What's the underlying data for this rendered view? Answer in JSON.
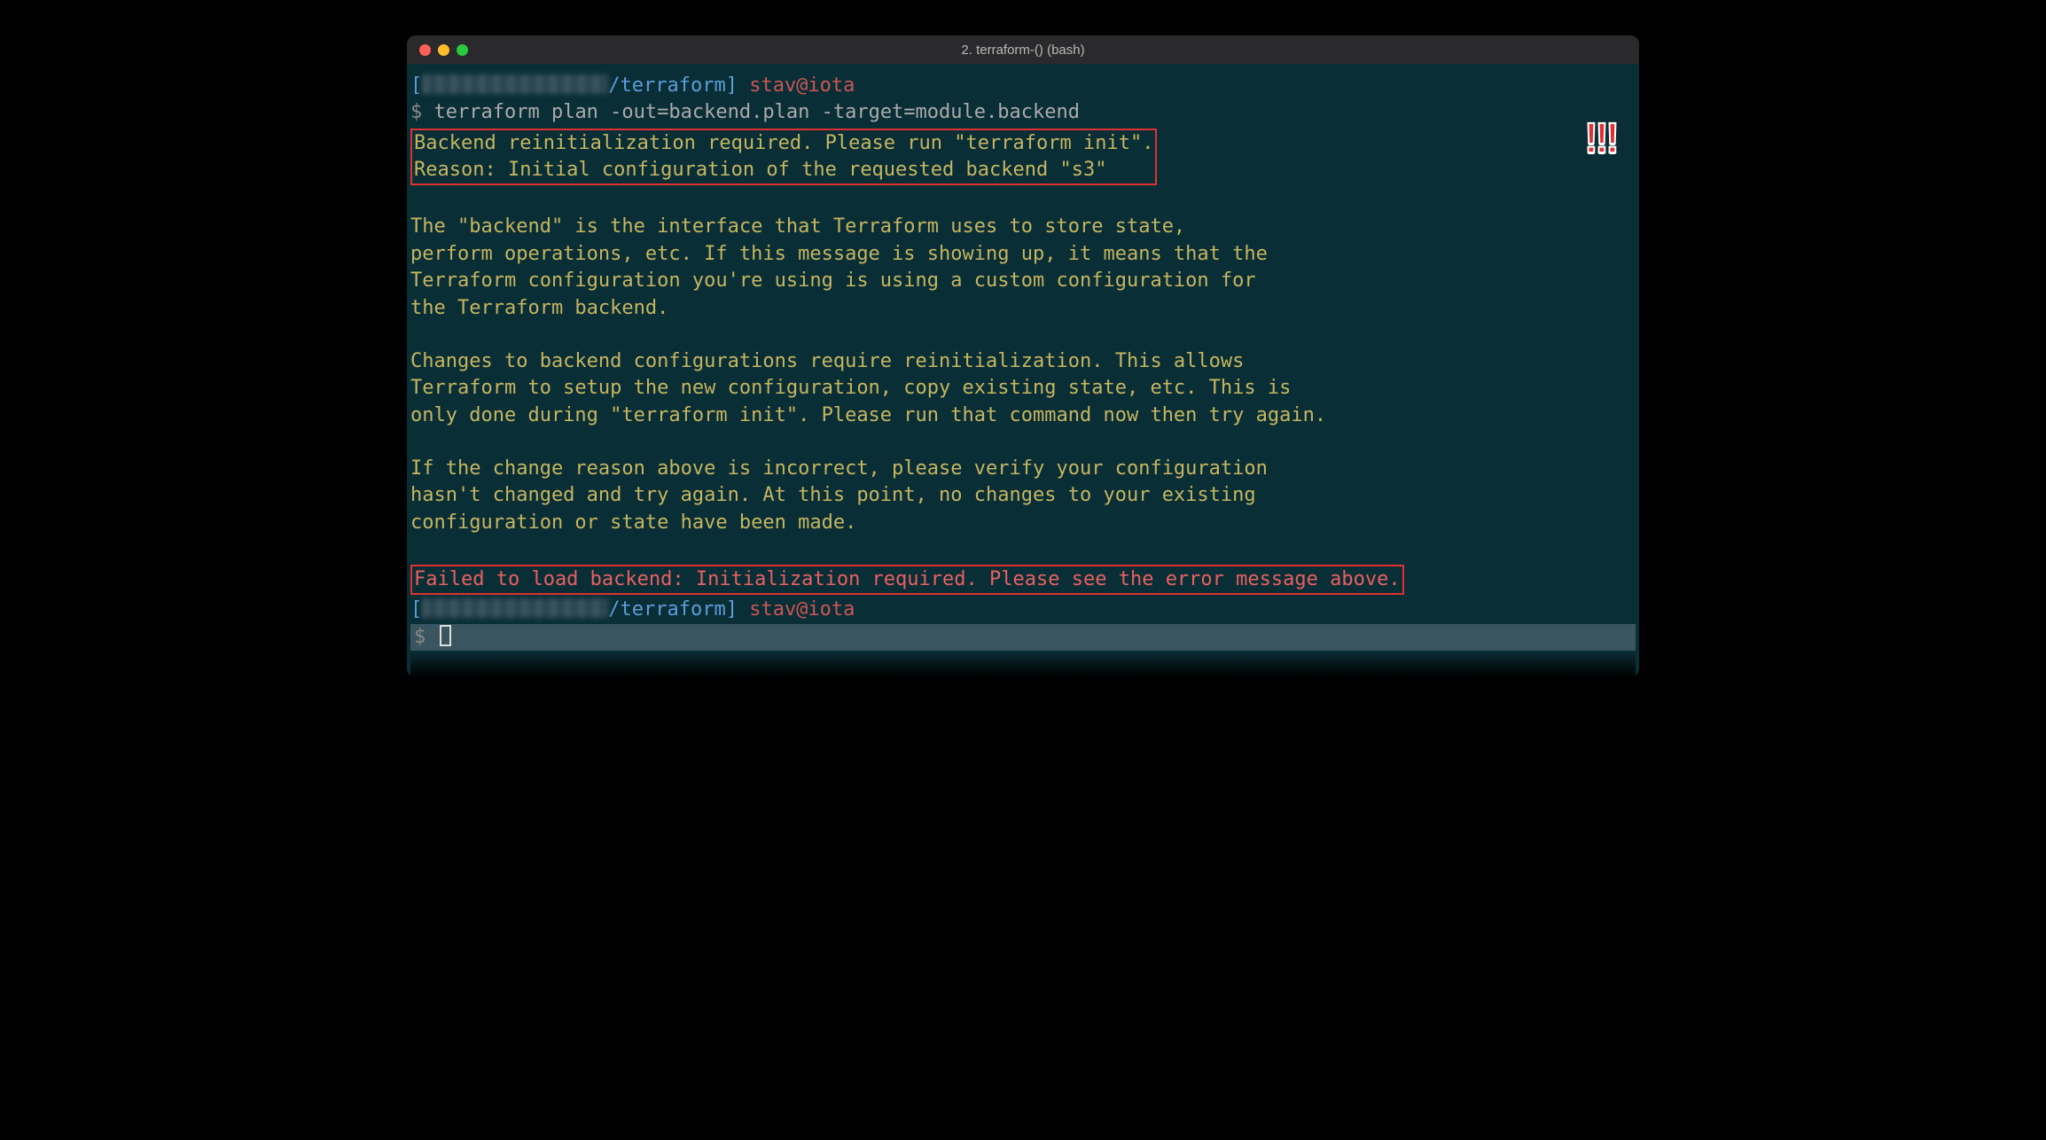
{
  "window_title": "2. terraform-() (bash)",
  "prompt1": {
    "bracket_open": "[",
    "path": "/terraform",
    "bracket_close": "] ",
    "userhost": "stav@iota"
  },
  "prompt_sym": "$ ",
  "command": "terraform plan -out=backend.plan -target=module.backend",
  "boxed_warning": {
    "l1": "Backend reinitialization required. Please run \"terraform init\".",
    "l2": "Reason: Initial configuration of the requested backend \"s3\""
  },
  "body": {
    "p1l1": "The \"backend\" is the interface that Terraform uses to store state,",
    "p1l2": "perform operations, etc. If this message is showing up, it means that the",
    "p1l3": "Terraform configuration you're using is using a custom configuration for",
    "p1l4": "the Terraform backend.",
    "p2l1": "Changes to backend configurations require reinitialization. This allows",
    "p2l2": "Terraform to setup the new configuration, copy existing state, etc. This is",
    "p2l3": "only done during \"terraform init\". Please run that command now then try again.",
    "p3l1": "If the change reason above is incorrect, please verify your configuration",
    "p3l2": "hasn't changed and try again. At this point, no changes to your existing",
    "p3l3": "configuration or state have been made."
  },
  "boxed_error": "Failed to load backend: Initialization required. Please see the error message above.",
  "prompt2": {
    "bracket_open": "[",
    "path": "/terraform",
    "bracket_close": "] ",
    "userhost": "stav@iota"
  },
  "exclaim": "!!!"
}
